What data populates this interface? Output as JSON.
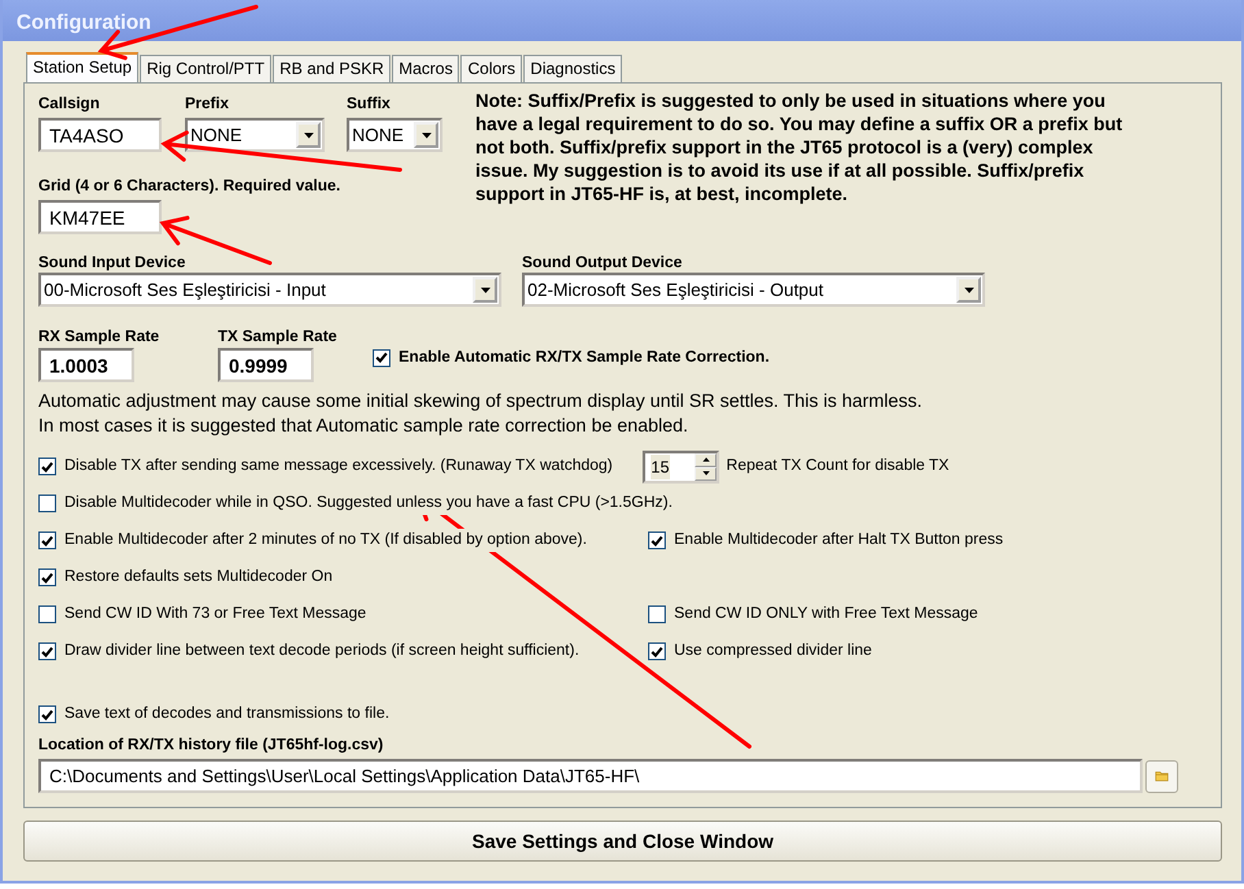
{
  "window": {
    "title": "Configuration"
  },
  "tabs": [
    {
      "label": "Station Setup",
      "selected": true
    },
    {
      "label": "Rig Control/PTT",
      "selected": false
    },
    {
      "label": "RB and PSKR",
      "selected": false
    },
    {
      "label": "Macros",
      "selected": false
    },
    {
      "label": "Colors",
      "selected": false
    },
    {
      "label": "Diagnostics",
      "selected": false
    }
  ],
  "callsign": {
    "label": "Callsign",
    "value": "TA4ASO"
  },
  "prefix": {
    "label": "Prefix",
    "value": "NONE"
  },
  "suffix": {
    "label": "Suffix",
    "value": "NONE"
  },
  "note": "Note:  Suffix/Prefix is suggested to only be used in situations where you have a legal requirement to do so.  You may define a suffix OR a prefix but not both.  Suffix/prefix support in the JT65 protocol is a (very) complex issue.  My suggestion is to avoid its use if at all possible.  Suffix/prefix support in JT65-HF is, at best, incomplete.",
  "grid": {
    "label": "Grid (4 or 6 Characters).  Required value.",
    "value": "KM47EE"
  },
  "sound_input": {
    "label": "Sound Input Device",
    "value": "00-Microsoft Ses Eşleştiricisi - Input"
  },
  "sound_output": {
    "label": "Sound Output Device",
    "value": "02-Microsoft Ses Eşleştiricisi - Output"
  },
  "rx_rate": {
    "label": "RX Sample Rate",
    "value": "1.0003"
  },
  "tx_rate": {
    "label": "TX Sample Rate",
    "value": "0.9999"
  },
  "auto_correction": {
    "label": "Enable Automatic RX/TX Sample Rate Correction.",
    "checked": true
  },
  "adjustment_note": [
    "Automatic adjustment may cause some initial skewing of spectrum display until SR settles.  This is harmless.",
    "In most cases it is suggested that Automatic sample rate correction be enabled."
  ],
  "options": [
    [
      {
        "kind": "checkbox",
        "label": "Disable TX after sending same message excessively. (Runaway TX watchdog)",
        "checked": true
      },
      {
        "kind": "spinner",
        "value": "15",
        "caption": "Repeat TX Count for disable TX"
      }
    ],
    [
      {
        "kind": "checkbox",
        "label": "Disable Multidecoder while in QSO.  Suggested unless you have a fast CPU (>1.5GHz).",
        "checked": false
      }
    ],
    [
      {
        "kind": "checkbox",
        "label": "Enable Multidecoder after 2 minutes of no TX (If disabled by option above).",
        "checked": true
      },
      {
        "kind": "checkbox",
        "label": "Enable Multidecoder after Halt TX Button press",
        "checked": true
      }
    ],
    [
      {
        "kind": "checkbox",
        "label": "Restore defaults sets Multidecoder On",
        "checked": true
      }
    ],
    [
      {
        "kind": "checkbox",
        "label": "Send CW ID With 73 or Free Text Message",
        "checked": false
      },
      {
        "kind": "checkbox",
        "label": "Send CW ID ONLY with Free Text Message",
        "checked": false
      }
    ],
    [
      {
        "kind": "checkbox",
        "label": "Draw divider line between text decode periods (if screen height sufficient).",
        "checked": true
      },
      {
        "kind": "checkbox",
        "label": "Use compressed divider line",
        "checked": true
      }
    ],
    [
      {
        "kind": "gap"
      }
    ],
    [
      {
        "kind": "checkbox",
        "label": "Save text of decodes and transmissions to file.",
        "checked": true
      }
    ]
  ],
  "history_file": {
    "label": "Location of RX/TX history file (JT65hf-log.csv)",
    "value": "C:\\Documents and Settings\\User\\Local Settings\\Application Data\\JT65-HF\\"
  },
  "buttons": [
    "Save Settings and Close Window"
  ]
}
